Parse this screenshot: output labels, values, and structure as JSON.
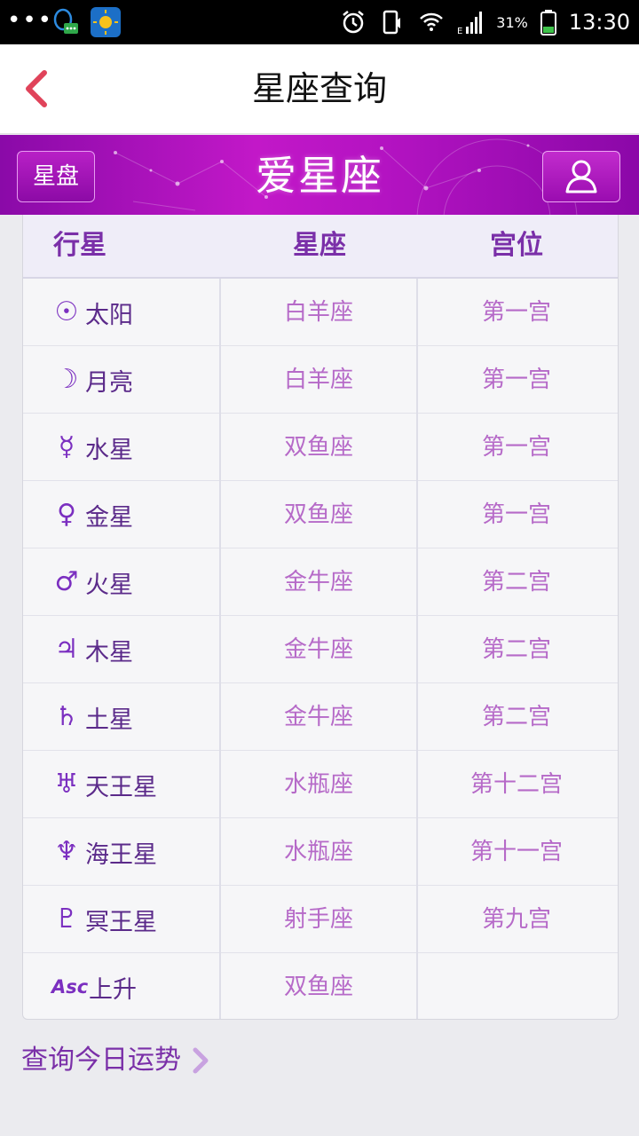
{
  "status_bar": {
    "battery_percent": "31%",
    "time": "13:30"
  },
  "header": {
    "title": "星座查询"
  },
  "banner": {
    "chart_button": "星盘",
    "title": "爱星座"
  },
  "table": {
    "headers": {
      "planet": "行星",
      "sign": "星座",
      "house": "宫位"
    },
    "rows": [
      {
        "glyph": "☉",
        "planet": "太阳",
        "sign": "白羊座",
        "house": "第一宫"
      },
      {
        "glyph": "☽",
        "planet": "月亮",
        "sign": "白羊座",
        "house": "第一宫"
      },
      {
        "glyph": "☿",
        "planet": "水星",
        "sign": "双鱼座",
        "house": "第一宫"
      },
      {
        "glyph": "♀",
        "planet": "金星",
        "sign": "双鱼座",
        "house": "第一宫"
      },
      {
        "glyph": "♂",
        "planet": "火星",
        "sign": "金牛座",
        "house": "第二宫"
      },
      {
        "glyph": "♃",
        "planet": "木星",
        "sign": "金牛座",
        "house": "第二宫"
      },
      {
        "glyph": "♄",
        "planet": "土星",
        "sign": "金牛座",
        "house": "第二宫"
      },
      {
        "glyph": "♅",
        "planet": "天王星",
        "sign": "水瓶座",
        "house": "第十二宫"
      },
      {
        "glyph": "♆",
        "planet": "海王星",
        "sign": "水瓶座",
        "house": "第十一宫"
      },
      {
        "glyph": "♇",
        "planet": "冥王星",
        "sign": "射手座",
        "house": "第九宫"
      },
      {
        "glyph": "Asc",
        "planet": "上升",
        "sign": "双鱼座",
        "house": ""
      }
    ]
  },
  "footer": {
    "link_label": "查询今日运势"
  },
  "colors": {
    "accent_purple": "#7a2fa8",
    "banner_magenta": "#c218c8",
    "back_arrow_red": "#e0435a",
    "cell_text": "#b66ac8"
  }
}
